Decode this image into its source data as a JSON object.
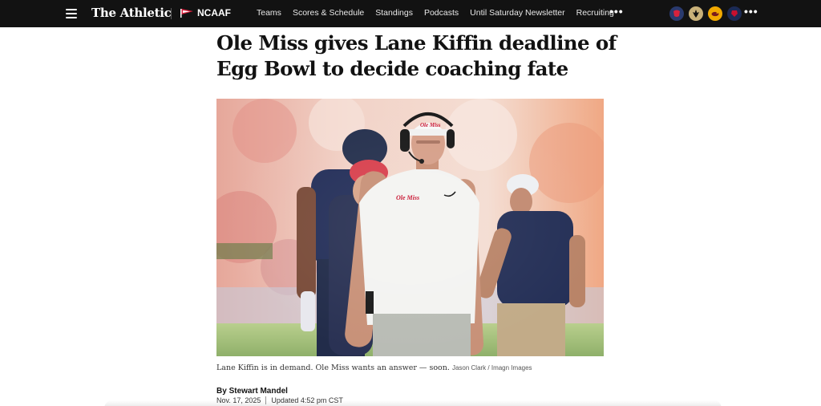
{
  "header": {
    "brand": "The Athletic",
    "league": "NCAAF",
    "nav": [
      "Teams",
      "Scores & Schedule",
      "Standings",
      "Podcasts",
      "Until Saturday Newsletter",
      "Recruiting"
    ],
    "more": "•••",
    "team_icons": [
      "ole-miss-logo",
      "saints-logo",
      "team-logo",
      "ole-miss-logo"
    ],
    "team_more": "•••",
    "colors": {
      "bar": "#121212",
      "text": "#ffffff"
    }
  },
  "article": {
    "headline": "Ole Miss gives Lane Kiffin deadline of Egg Bowl to decide coaching fate",
    "image_caption": "Lane Kiffin is in demand. Ole Miss wants an answer — soon.",
    "image_credit": "Jason Clark / Imagn Images",
    "byline_prefix": "By",
    "author": "Stewart Mandel",
    "published": "Nov. 17, 2025",
    "updated": "Updated 4:52 pm CST",
    "cap_logo": "Ole Miss",
    "shirt_logo": "Ole Miss"
  }
}
